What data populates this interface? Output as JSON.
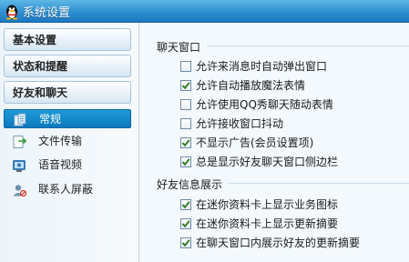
{
  "window": {
    "title": "系统设置",
    "icon": "qq-penguin-icon"
  },
  "sidebar": {
    "categories": [
      {
        "label": "基本设置"
      },
      {
        "label": "状态和提醒"
      },
      {
        "label": "好友和聊天"
      }
    ],
    "items": [
      {
        "label": "常规",
        "icon": "general-settings-icon",
        "selected": true
      },
      {
        "label": "文件传输",
        "icon": "file-transfer-icon",
        "selected": false
      },
      {
        "label": "语音视频",
        "icon": "voice-video-icon",
        "selected": false
      },
      {
        "label": "联系人屏蔽",
        "icon": "contact-block-icon",
        "selected": false
      }
    ]
  },
  "main": {
    "chat_window": {
      "title": "聊天窗口",
      "options": [
        {
          "label": "允许来消息时自动弹出窗口",
          "checked": false
        },
        {
          "label": "允许自动播放魔法表情",
          "checked": true
        },
        {
          "label": "允许使用QQ秀聊天随动表情",
          "checked": false
        },
        {
          "label": "允许接收窗口抖动",
          "checked": false
        },
        {
          "label": "不显示广告(会员设置项)",
          "checked": true
        },
        {
          "label": "总是显示好友聊天窗口侧边栏",
          "checked": true
        }
      ]
    },
    "friend_info": {
      "title": "好友信息展示",
      "options": [
        {
          "label": "在迷你资料卡上显示业务图标",
          "checked": true
        },
        {
          "label": "在迷你资料卡上显示更新摘要",
          "checked": true
        },
        {
          "label": "在聊天窗口内展示好友的更新摘要",
          "checked": true
        }
      ]
    }
  },
  "colors": {
    "titlebar": "#2e8fd1",
    "selected_item": "#1f9ad8",
    "checkmark": "#2a7a1e"
  }
}
